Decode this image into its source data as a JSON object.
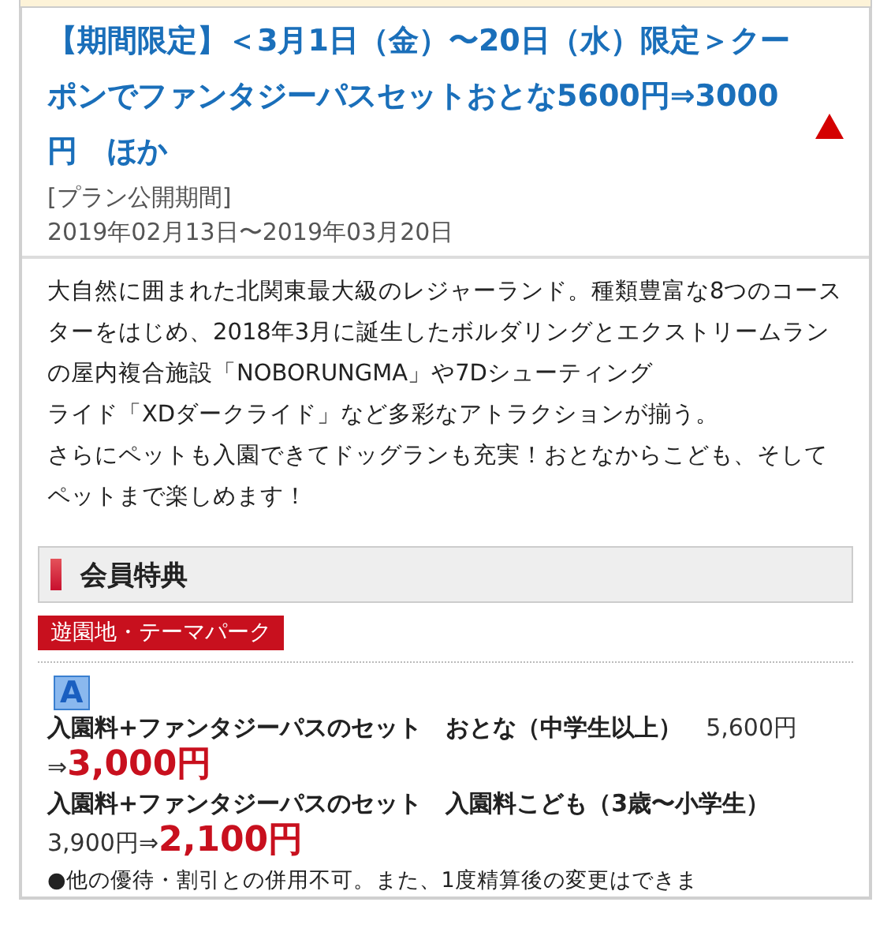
{
  "plan": {
    "title": "【期間限定】＜3月1日（金）〜20日（水）限定＞クーポンでファンタジーパスセットおとな5600円⇒3000円　ほか",
    "expanded": true,
    "period_label": "[プラン公開期間]",
    "period": "2019年02月13日〜2019年03月20日"
  },
  "description": [
    "大自然に囲まれた北関東最大級のレジャーランド。種類豊富な8つのコースターをはじめ、2018年3月に誕生したボルダリングとエクストリームランの屋内複合施設「NOBORUNGMA」や7Dシューティング",
    "ライド「XDダークライド」など多彩なアトラクションが揃う。",
    "さらにペットも入園できてドッグランも充実！おとなからこども、そしてペットまで楽しめます！"
  ],
  "benefits": {
    "heading": "会員特典",
    "category": "遊園地・テーマパーク",
    "grade": "A",
    "items": [
      {
        "name": "入園料+ファンタジーパスのセット　おとな（中学生以上）",
        "regular_price": "5,600円",
        "arrow": "⇒",
        "sale_price": "3,000円"
      },
      {
        "name": "入園料+ファンタジーパスのセット　入園料こども（3歳〜小学生）",
        "regular_price": "3,900円",
        "arrow": "⇒",
        "sale_price": "2,100円"
      }
    ],
    "note": "●他の優待・割引との併用不可。また、1度精算後の変更はできま"
  }
}
